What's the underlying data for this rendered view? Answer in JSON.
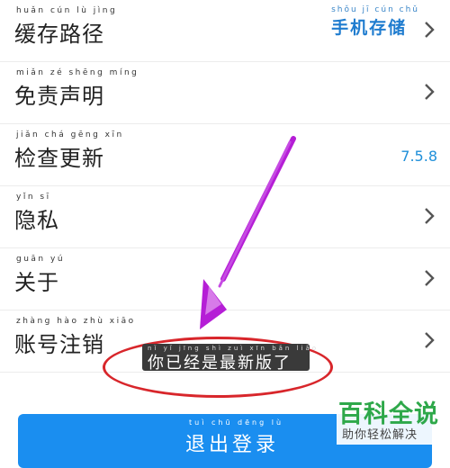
{
  "settings": {
    "items": [
      {
        "pinyin": "huǎn cún lù jìng",
        "label": "缓存路径",
        "value_pinyin": "shǒu jī cún chǔ",
        "value": "手机存储",
        "version": "",
        "chevron": true
      },
      {
        "pinyin": "miǎn zé shēng míng",
        "label": "免责声明",
        "value_pinyin": "",
        "value": "",
        "version": "",
        "chevron": true
      },
      {
        "pinyin": "jiǎn chá gēng xīn",
        "label": "检查更新",
        "value_pinyin": "",
        "value": "",
        "version": "7.5.8",
        "chevron": false
      },
      {
        "pinyin": "yǐn sī",
        "label": "隐私",
        "value_pinyin": "",
        "value": "",
        "version": "",
        "chevron": true
      },
      {
        "pinyin": "guān yú",
        "label": "关于",
        "value_pinyin": "",
        "value": "",
        "version": "",
        "chevron": true
      },
      {
        "pinyin": "zhàng hào zhù xiāo",
        "label": "账号注销",
        "value_pinyin": "",
        "value": "",
        "version": "",
        "chevron": true
      }
    ]
  },
  "toast": {
    "pinyin": "nǐ yǐ jīng shì zuì xīn bǎn liǎo",
    "text": "你已经是最新版了"
  },
  "logout": {
    "pinyin": "tuì chū dēng lù",
    "label": "退出登录"
  },
  "watermark": {
    "brand": "百科全说",
    "tagline": "助你轻松解决"
  },
  "colors": {
    "accent": "#1a8ef0",
    "annotation_arrow": "#b51ed6",
    "annotation_oval": "#d8262b",
    "brand_green": "#2ea84a"
  }
}
